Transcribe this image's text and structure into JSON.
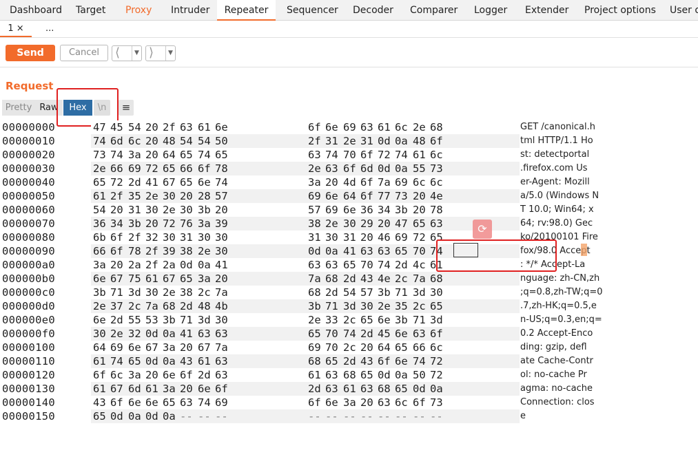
{
  "top_tabs": [
    {
      "label": "Dashboard"
    },
    {
      "label": "Target"
    },
    {
      "label": "Proxy"
    },
    {
      "label": "Intruder"
    },
    {
      "label": "Repeater"
    },
    {
      "label": "Sequencer"
    },
    {
      "label": "Decoder"
    },
    {
      "label": "Comparer"
    },
    {
      "label": "Logger"
    },
    {
      "label": "Extender"
    },
    {
      "label": "Project options"
    },
    {
      "label": "User o"
    }
  ],
  "sub_tabs": [
    {
      "label": "1 ×"
    },
    {
      "label": "..."
    }
  ],
  "toolbar": {
    "send_label": "Send",
    "cancel_label": "Cancel",
    "back_icon": "chevron-left-icon",
    "forward_icon": "chevron-right-icon"
  },
  "request": {
    "title": "Request",
    "view_buttons": {
      "pretty": "Pretty",
      "raw": "Raw",
      "hex": "Hex",
      "newline": "\\n",
      "menu_icon": "menu-icon"
    }
  },
  "colors": {
    "accent": "#f26b2b",
    "hex_selected": "#2e6da4",
    "highlight_box": "#e02020"
  },
  "hex_rows": [
    {
      "offset": "00000000",
      "bytes": [
        "47",
        "45",
        "54",
        "20",
        "2f",
        "63",
        "61",
        "6e",
        "6f",
        "6e",
        "69",
        "63",
        "61",
        "6c",
        "2e",
        "68"
      ],
      "ascii": "GET /canonical.h"
    },
    {
      "offset": "00000010",
      "bytes": [
        "74",
        "6d",
        "6c",
        "20",
        "48",
        "54",
        "54",
        "50",
        "2f",
        "31",
        "2e",
        "31",
        "0d",
        "0a",
        "48",
        "6f"
      ],
      "ascii": "tml HTTP/1.1 Ho"
    },
    {
      "offset": "00000020",
      "bytes": [
        "73",
        "74",
        "3a",
        "20",
        "64",
        "65",
        "74",
        "65",
        "63",
        "74",
        "70",
        "6f",
        "72",
        "74",
        "61",
        "6c"
      ],
      "ascii": "st: detectportal"
    },
    {
      "offset": "00000030",
      "bytes": [
        "2e",
        "66",
        "69",
        "72",
        "65",
        "66",
        "6f",
        "78",
        "2e",
        "63",
        "6f",
        "6d",
        "0d",
        "0a",
        "55",
        "73"
      ],
      "ascii": ".firefox.com Us"
    },
    {
      "offset": "00000040",
      "bytes": [
        "65",
        "72",
        "2d",
        "41",
        "67",
        "65",
        "6e",
        "74",
        "3a",
        "20",
        "4d",
        "6f",
        "7a",
        "69",
        "6c",
        "6c"
      ],
      "ascii": "er-Agent: Mozill"
    },
    {
      "offset": "00000050",
      "bytes": [
        "61",
        "2f",
        "35",
        "2e",
        "30",
        "20",
        "28",
        "57",
        "69",
        "6e",
        "64",
        "6f",
        "77",
        "73",
        "20",
        "4e"
      ],
      "ascii": "a/5.0 (Windows N"
    },
    {
      "offset": "00000060",
      "bytes": [
        "54",
        "20",
        "31",
        "30",
        "2e",
        "30",
        "3b",
        "20",
        "57",
        "69",
        "6e",
        "36",
        "34",
        "3b",
        "20",
        "78"
      ],
      "ascii": "T 10.0; Win64; x"
    },
    {
      "offset": "00000070",
      "bytes": [
        "36",
        "34",
        "3b",
        "20",
        "72",
        "76",
        "3a",
        "39",
        "38",
        "2e",
        "30",
        "29",
        "20",
        "47",
        "65",
        "63"
      ],
      "ascii": "64; rv:98.0) Gec"
    },
    {
      "offset": "00000080",
      "bytes": [
        "6b",
        "6f",
        "2f",
        "32",
        "30",
        "31",
        "30",
        "30",
        "31",
        "30",
        "31",
        "20",
        "46",
        "69",
        "72",
        "65"
      ],
      "ascii": "ko/20100101 Fire"
    },
    {
      "offset": "00000090",
      "bytes": [
        "66",
        "6f",
        "78",
        "2f",
        "39",
        "38",
        "2e",
        "30",
        "0d",
        "0a",
        "41",
        "63",
        "63",
        "65",
        "70",
        "74"
      ],
      "ascii": "fox/98.0 Accept"
    },
    {
      "offset": "000000a0",
      "bytes": [
        "3a",
        "20",
        "2a",
        "2f",
        "2a",
        "0d",
        "0a",
        "41",
        "63",
        "63",
        "65",
        "70",
        "74",
        "2d",
        "4c",
        "61"
      ],
      "ascii": ": */* Accept-La"
    },
    {
      "offset": "000000b0",
      "bytes": [
        "6e",
        "67",
        "75",
        "61",
        "67",
        "65",
        "3a",
        "20",
        "7a",
        "68",
        "2d",
        "43",
        "4e",
        "2c",
        "7a",
        "68"
      ],
      "ascii": "nguage: zh-CN,zh"
    },
    {
      "offset": "000000c0",
      "bytes": [
        "3b",
        "71",
        "3d",
        "30",
        "2e",
        "38",
        "2c",
        "7a",
        "68",
        "2d",
        "54",
        "57",
        "3b",
        "71",
        "3d",
        "30"
      ],
      "ascii": ";q=0.8,zh-TW;q=0"
    },
    {
      "offset": "000000d0",
      "bytes": [
        "2e",
        "37",
        "2c",
        "7a",
        "68",
        "2d",
        "48",
        "4b",
        "3b",
        "71",
        "3d",
        "30",
        "2e",
        "35",
        "2c",
        "65"
      ],
      "ascii": ".7,zh-HK;q=0.5,e"
    },
    {
      "offset": "000000e0",
      "bytes": [
        "6e",
        "2d",
        "55",
        "53",
        "3b",
        "71",
        "3d",
        "30",
        "2e",
        "33",
        "2c",
        "65",
        "6e",
        "3b",
        "71",
        "3d"
      ],
      "ascii": "n-US;q=0.3,en;q="
    },
    {
      "offset": "000000f0",
      "bytes": [
        "30",
        "2e",
        "32",
        "0d",
        "0a",
        "41",
        "63",
        "63",
        "65",
        "70",
        "74",
        "2d",
        "45",
        "6e",
        "63",
        "6f"
      ],
      "ascii": "0.2 Accept-Enco"
    },
    {
      "offset": "00000100",
      "bytes": [
        "64",
        "69",
        "6e",
        "67",
        "3a",
        "20",
        "67",
        "7a",
        "69",
        "70",
        "2c",
        "20",
        "64",
        "65",
        "66",
        "6c"
      ],
      "ascii": "ding: gzip, defl"
    },
    {
      "offset": "00000110",
      "bytes": [
        "61",
        "74",
        "65",
        "0d",
        "0a",
        "43",
        "61",
        "63",
        "68",
        "65",
        "2d",
        "43",
        "6f",
        "6e",
        "74",
        "72"
      ],
      "ascii": "ate Cache-Contr"
    },
    {
      "offset": "00000120",
      "bytes": [
        "6f",
        "6c",
        "3a",
        "20",
        "6e",
        "6f",
        "2d",
        "63",
        "61",
        "63",
        "68",
        "65",
        "0d",
        "0a",
        "50",
        "72"
      ],
      "ascii": "ol: no-cache Pr"
    },
    {
      "offset": "00000130",
      "bytes": [
        "61",
        "67",
        "6d",
        "61",
        "3a",
        "20",
        "6e",
        "6f",
        "2d",
        "63",
        "61",
        "63",
        "68",
        "65",
        "0d",
        "0a"
      ],
      "ascii": "agma: no-cache"
    },
    {
      "offset": "00000140",
      "bytes": [
        "43",
        "6f",
        "6e",
        "6e",
        "65",
        "63",
        "74",
        "69",
        "6f",
        "6e",
        "3a",
        "20",
        "63",
        "6c",
        "6f",
        "73"
      ],
      "ascii": "Connection: clos"
    },
    {
      "offset": "00000150",
      "bytes": [
        "65",
        "0d",
        "0a",
        "0d",
        "0a",
        "--",
        "--",
        "--",
        "--",
        "--",
        "--",
        "--",
        "--",
        "--",
        "--",
        "--"
      ],
      "ascii": "e"
    }
  ]
}
